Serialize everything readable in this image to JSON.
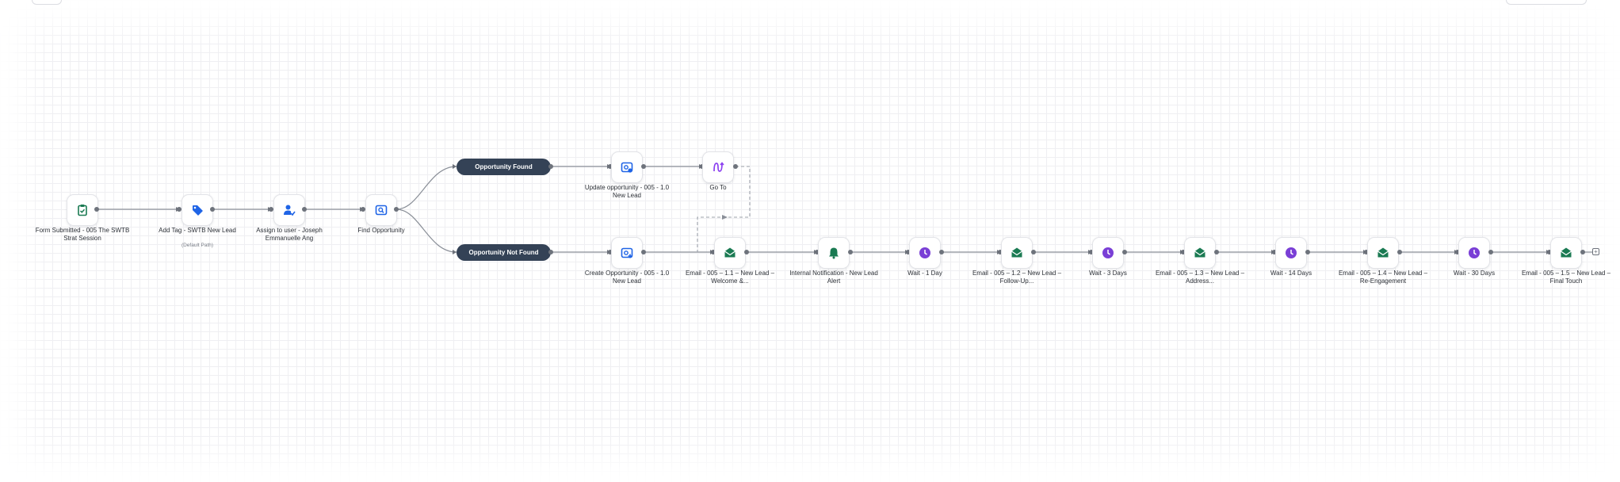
{
  "colors": {
    "action_blue": "#1f64e6",
    "email_green": "#1a7a52",
    "wait_purple": "#7a3fd6",
    "goto_purple": "#8b3ff0",
    "pill_bg": "#344256",
    "connector": "#8a8f98"
  },
  "nodes": {
    "form_submitted": {
      "label": "Form Submitted - 005 The SWTB Strat Session",
      "icon": "clipboard-icon"
    },
    "add_tag": {
      "label": "Add Tag - SWTB New Lead",
      "sublabel": "(Default Path)",
      "icon": "tag-icon"
    },
    "assign_user": {
      "label": "Assign to user - Joseph Emmanuelle Ang",
      "icon": "assign-user-icon"
    },
    "find_opportunity": {
      "label": "Find Opportunity",
      "icon": "find-opportunity-icon"
    },
    "opportunity_found": {
      "label": "Opportunity Found"
    },
    "opportunity_not_found": {
      "label": "Opportunity Not Found"
    },
    "update_opportunity": {
      "label": "Update opportunity - 005 - 1.0 New Lead",
      "icon": "update-opportunity-icon"
    },
    "go_to": {
      "label": "Go To",
      "icon": "goto-icon"
    },
    "create_opportunity": {
      "label": "Create Opportunity - 005 - 1.0 New Lead",
      "icon": "create-opportunity-icon"
    },
    "email_11": {
      "label": "Email - 005 – 1.1 – New Lead – Welcome &...",
      "icon": "envelope-icon"
    },
    "internal_notification": {
      "label": "Internal Notification - New Lead Alert",
      "icon": "bell-icon"
    },
    "wait_1": {
      "label": "Wait - 1 Day",
      "icon": "clock-icon"
    },
    "email_12": {
      "label": "Email - 005 – 1.2 – New Lead – Follow-Up...",
      "icon": "envelope-icon"
    },
    "wait_3": {
      "label": "Wait - 3 Days",
      "icon": "clock-icon"
    },
    "email_13": {
      "label": "Email - 005 – 1.3 – New Lead – Address...",
      "icon": "envelope-icon"
    },
    "wait_14": {
      "label": "Wait - 14 Days",
      "icon": "clock-icon"
    },
    "email_14": {
      "label": "Email - 005 – 1.4 – New Lead – Re-Engagement",
      "icon": "envelope-icon"
    },
    "wait_30": {
      "label": "Wait - 30 Days",
      "icon": "clock-icon"
    },
    "email_15": {
      "label": "Email - 005 – 1.5 – New Lead – Final Touch",
      "icon": "envelope-icon"
    }
  },
  "end_button": {
    "symbol": "+"
  }
}
